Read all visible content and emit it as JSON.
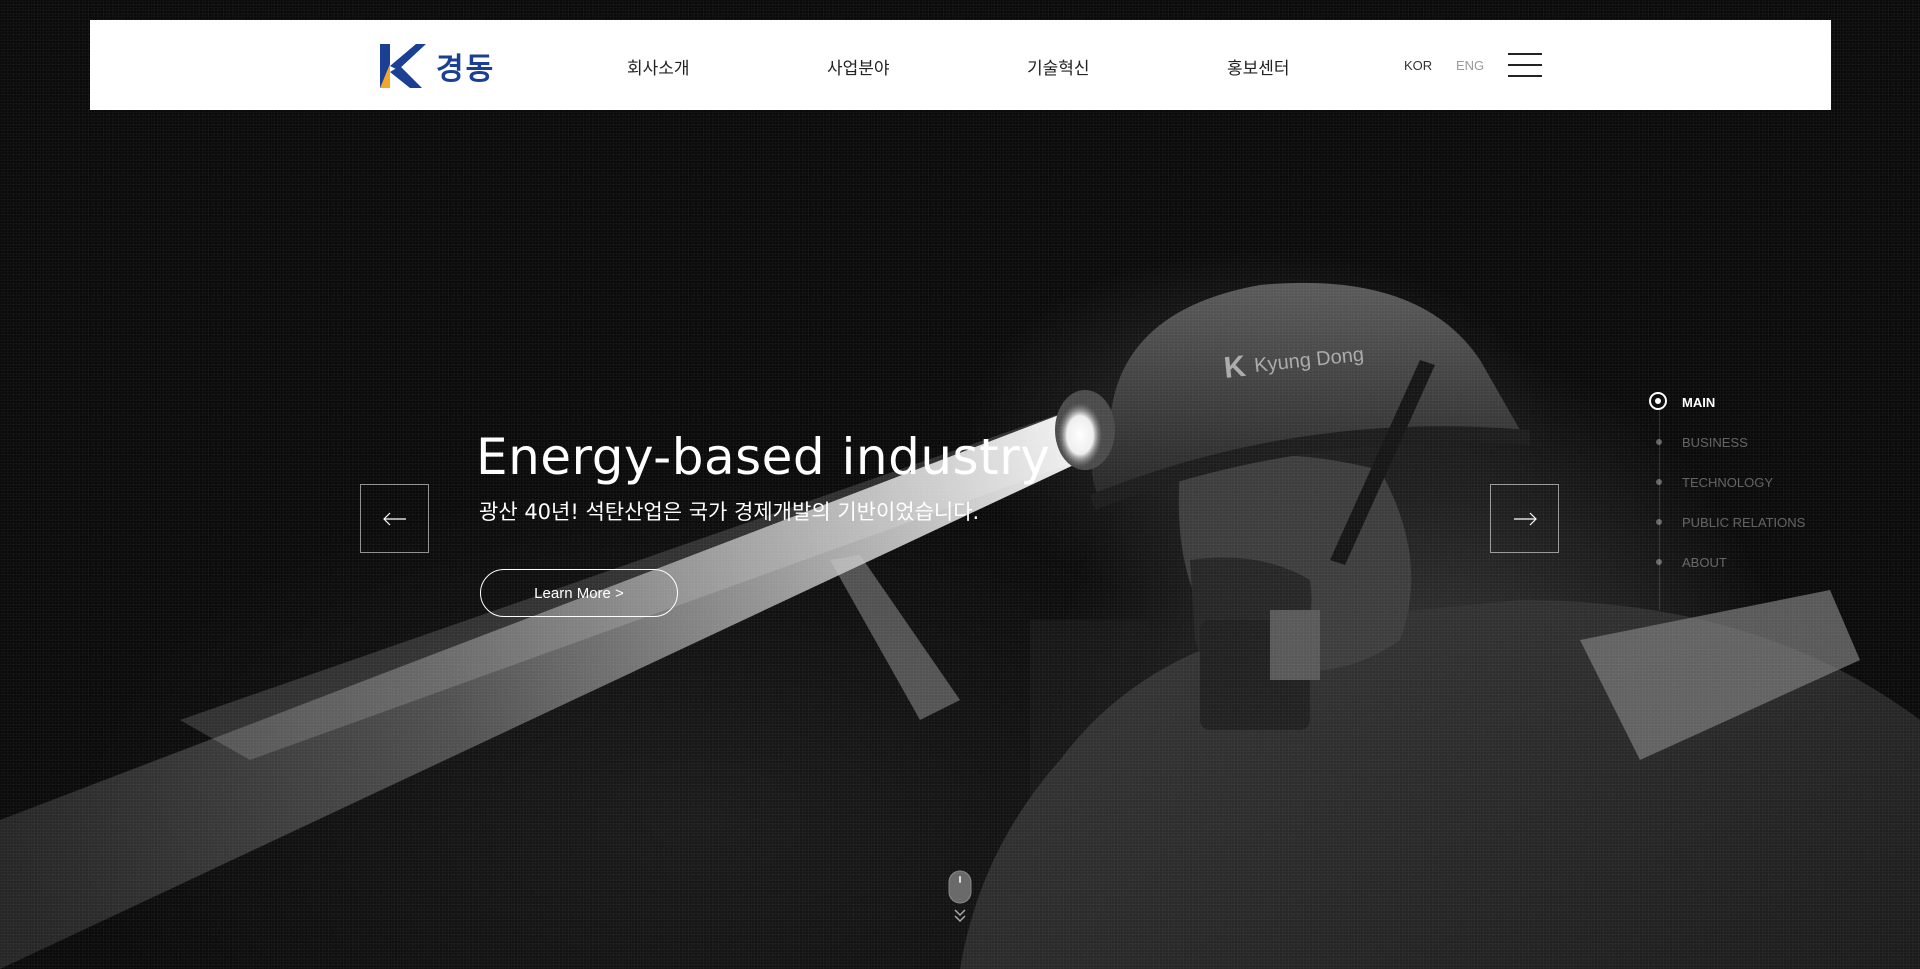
{
  "brand": {
    "logo_text": "경동",
    "logo_alt": "K",
    "colors": {
      "primary": "#1b3f93",
      "accent": "#f4a62a"
    }
  },
  "nav": {
    "items": [
      {
        "label": "회사소개"
      },
      {
        "label": "사업분야"
      },
      {
        "label": "기술혁신"
      },
      {
        "label": "홍보센터"
      }
    ],
    "languages": [
      {
        "label": "KOR",
        "active": true
      },
      {
        "label": "ENG",
        "active": false
      }
    ],
    "menu_icon": "hamburger-icon"
  },
  "hero": {
    "title": "Energy-based industry",
    "subtitle": "광산 40년! 석탄산업은 국가 경제개발의 기반이었습니다.",
    "cta_label": "Learn More >",
    "prev_icon": "arrow-left-icon",
    "next_icon": "arrow-right-icon",
    "helmet_text": "Kyung Dong"
  },
  "side_nav": {
    "items": [
      {
        "label": "MAIN",
        "active": true
      },
      {
        "label": "BUSINESS",
        "active": false
      },
      {
        "label": "TECHNOLOGY",
        "active": false
      },
      {
        "label": "PUBLIC RELATIONS",
        "active": false
      },
      {
        "label": "ABOUT",
        "active": false
      }
    ]
  },
  "scroll_indicator": {
    "icon": "mouse-scroll-icon"
  }
}
